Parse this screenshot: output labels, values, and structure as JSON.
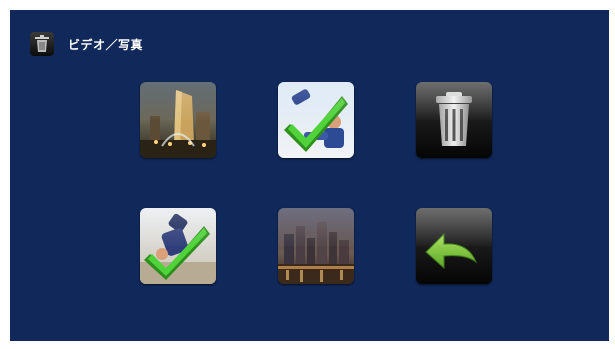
{
  "header": {
    "title": "ビデオ／写真",
    "icon": "trash-icon"
  },
  "tiles": [
    {
      "name": "photo-city-fountain",
      "icon": "photo-thumbnail",
      "selected": false
    },
    {
      "name": "photo-skater-1",
      "icon": "photo-thumbnail",
      "selected": true
    },
    {
      "name": "delete",
      "icon": "trash-icon"
    },
    {
      "name": "photo-skater-2",
      "icon": "photo-thumbnail",
      "selected": true
    },
    {
      "name": "photo-city-night",
      "icon": "photo-thumbnail",
      "selected": false
    },
    {
      "name": "back",
      "icon": "back-arrow-icon"
    }
  ],
  "colors": {
    "background": "#11285a",
    "check_green": "#3fbf2a",
    "arrow_green": "#7cc63a"
  }
}
